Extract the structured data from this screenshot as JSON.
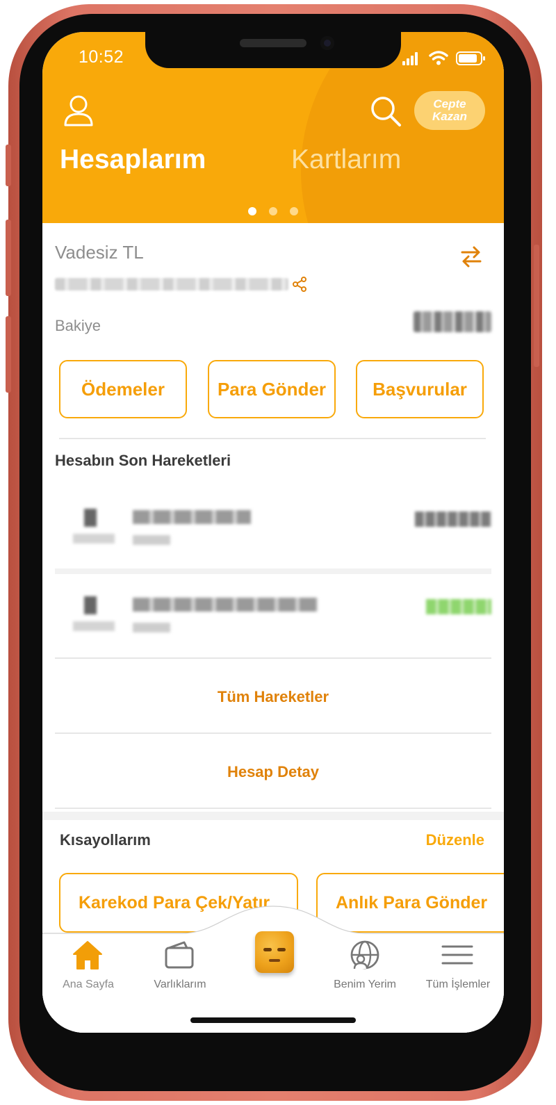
{
  "status_bar": {
    "time": "10:52"
  },
  "header": {
    "cepte_kazan_line1": "Cepte",
    "cepte_kazan_line2": "Kazan",
    "tabs": [
      {
        "label": "Hesaplarım",
        "active": true
      },
      {
        "label": "Kartlarım",
        "active": false
      }
    ],
    "page_dots": 3,
    "active_dot": 1,
    "color": "#f9a90a"
  },
  "account": {
    "name": "Vadesiz TL",
    "balance_label": "Bakiye"
  },
  "actions": [
    {
      "label": "Ödemeler"
    },
    {
      "label": "Para Gönder"
    },
    {
      "label": "Başvurular"
    }
  ],
  "transactions": {
    "title": "Hesabın Son Hareketleri",
    "all_link": "Tüm Hareketler",
    "detail_link": "Hesap Detay"
  },
  "shortcuts": {
    "title": "Kısayollarım",
    "edit_label": "Düzenle",
    "items": [
      {
        "label": "Karekod Para Çek/Yatır"
      },
      {
        "label": "Anlık Para Gönder"
      }
    ]
  },
  "tabbar": {
    "items": [
      {
        "label": "Ana Sayfa",
        "icon": "home-icon",
        "active": true
      },
      {
        "label": "Varlıklarım",
        "icon": "wallet-icon",
        "active": false
      },
      {
        "label": "Benim Yerim",
        "icon": "globe-user-icon",
        "active": false
      },
      {
        "label": "Tüm İşlemler",
        "icon": "menu-icon",
        "active": false
      }
    ]
  },
  "colors": {
    "accent": "#f9a90a",
    "accent_text": "#f59e08",
    "link": "#e0820a",
    "frame": "#e07a68"
  }
}
